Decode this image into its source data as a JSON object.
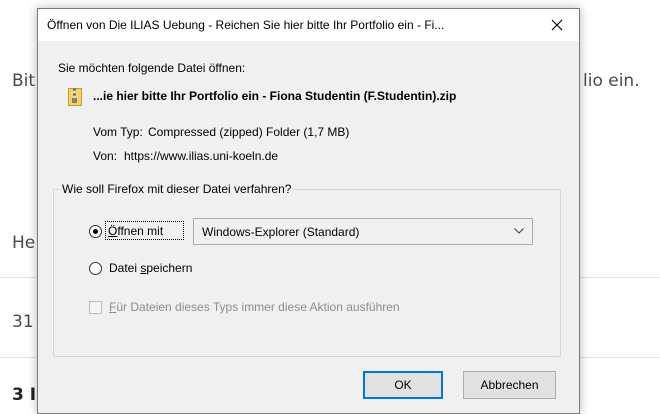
{
  "background": {
    "line1_left": "Bit",
    "line1_right": "lio ein.",
    "line2_left": "He",
    "line3_left": "31",
    "line4_left": "3 I"
  },
  "dialog": {
    "title": "Öffnen von Die ILIAS Uebung - Reichen Sie hier bitte Ihr Portfolio ein - Fi...",
    "intro": "Sie möchten folgende Datei öffnen:",
    "filename": "...ie hier bitte Ihr Portfolio ein - Fiona Studentin (F.Studentin).zip",
    "type_label": "Vom Typ:",
    "type_value": "Compressed (zipped) Folder (1,7 MB)",
    "from_label": "Von:",
    "from_value": "https://www.ilias.uni-koeln.de",
    "group_legend": "Wie soll Firefox mit dieser Datei verfahren?",
    "open_with": {
      "accel": "Ö",
      "rest": "ffnen mit"
    },
    "app_select": {
      "value": "Windows-Explorer (Standard)"
    },
    "save_file": {
      "pre": "Datei ",
      "accel": "s",
      "post": "peichern"
    },
    "always_action": {
      "accel": "F",
      "rest": "ür Dateien dieses Typs immer diese Aktion ausführen"
    },
    "ok_label": "OK",
    "cancel_label": "Abbrechen"
  }
}
